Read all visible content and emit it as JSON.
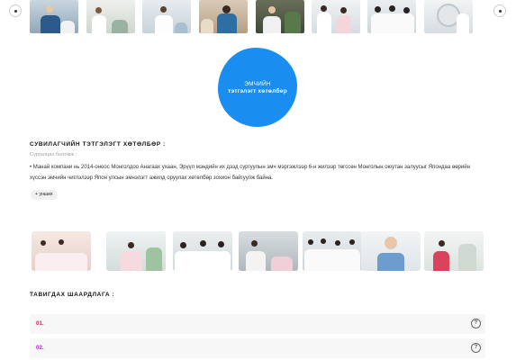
{
  "top_carousel": {
    "nav_prev_icon": "chevron-left-icon",
    "nav_next_icon": "chevron-right-icon",
    "images": [
      "top-image-1",
      "top-image-2",
      "top-image-3",
      "top-image-4",
      "top-image-5",
      "top-image-6",
      "top-image-7",
      "top-image-8"
    ]
  },
  "program_circle": {
    "line1": "ЭМЧИЙН",
    "line2": "тэтгэлэгт хөтөлбөр",
    "color": "#1a8df0"
  },
  "nursing": {
    "title": "СУВИЛАГЧИЙН ТЭТГЭЛЭГТ ХӨТӨЛБӨР :",
    "subtitle": "Сургалцах боломж :",
    "description": "• Манай компани нь 2014-оноос Монголдоо Анагаах ухаан, Эрүүл мэндийн их дээд сургуулын эмч мэргэжлээр 6-н жилээр төгссөн Монголын оюутан залуусыг Япондаа өөрийн хүссэн эмчийн чиглэлээр Япон улсын эмнэлэгт ажилд оруулах хөтөлбөр зохион байгуулж байна.",
    "more_button": "+ унших"
  },
  "gallery": {
    "images": [
      "gallery-image-1",
      "gallery-image-2",
      "gallery-image-3",
      "gallery-image-4",
      "gallery-image-5",
      "gallery-image-6",
      "gallery-image-7"
    ]
  },
  "requirements": {
    "title": "ТАВИГДАХ ШААРДЛАГА :",
    "items": [
      {
        "number": "01.",
        "color": "#e0245e"
      },
      {
        "number": "02.",
        "color": "#b82ad6"
      }
    ],
    "help_icon": "question-icon",
    "help_symbol": "?"
  }
}
